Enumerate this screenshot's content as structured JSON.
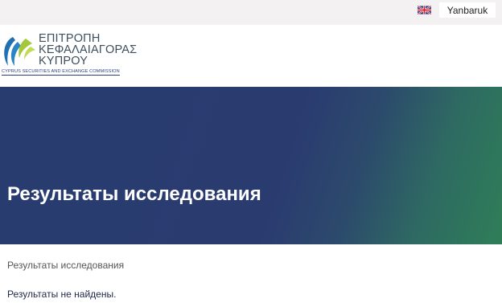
{
  "topbar": {
    "language_flag_icon": "uk-flag-icon",
    "user_label": "Yanbaruk"
  },
  "header": {
    "logo": {
      "line1": "ΕΠΙΤΡΟΠΗ",
      "line2": "ΚΕΦΑΛΑΙΑΓΟΡΑΣ",
      "line3": "ΚΥΠΡΟΥ",
      "subtitle": "CYPRUS SECURITIES AND EXCHANGE COMMISSION",
      "colors": {
        "blue": "#1f6fb2",
        "green": "#a3c93a",
        "text": "#3d4f5e"
      }
    }
  },
  "hero": {
    "title": "Результаты исследования",
    "colors": {
      "start": "#283c70",
      "end": "#2f7e58"
    }
  },
  "content": {
    "breadcrumb": "Результаты исследования",
    "message": "Результаты не найдены."
  }
}
